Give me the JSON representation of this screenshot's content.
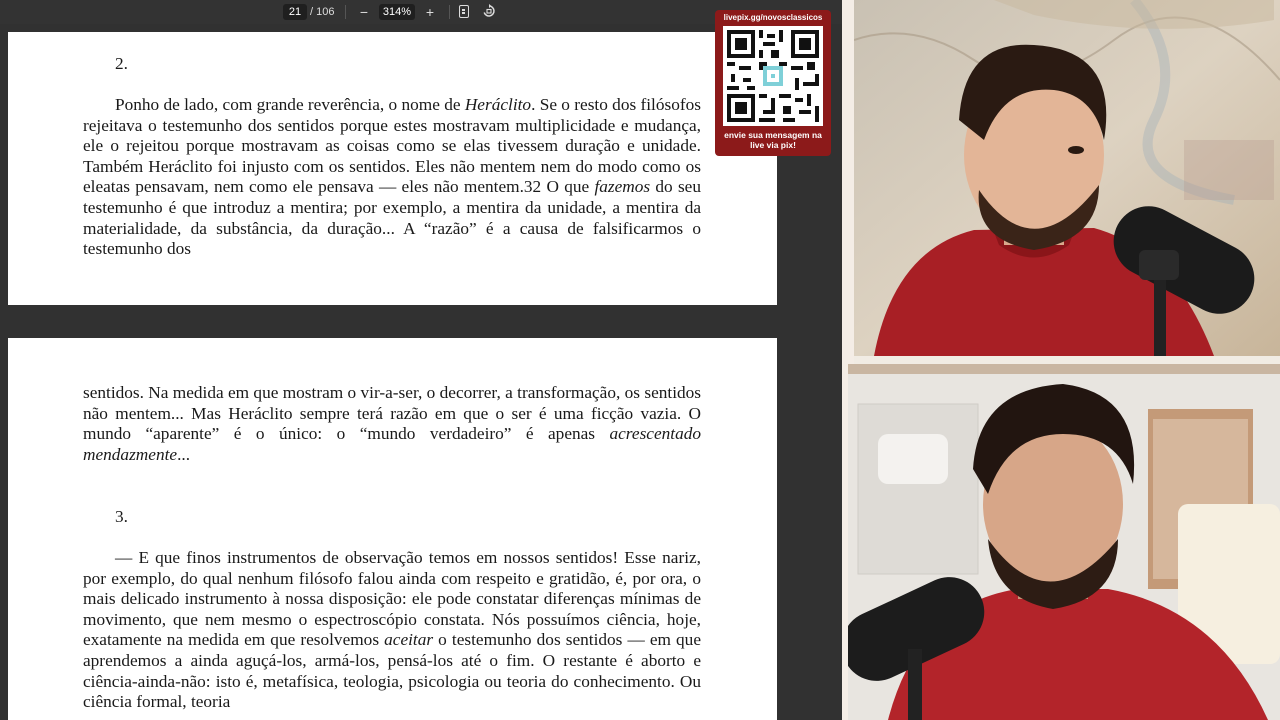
{
  "toolbar": {
    "current_page": "21",
    "total_pages": "/ 106",
    "zoom_out_label": "−",
    "zoom_level": "314%",
    "zoom_in_label": "+",
    "fit_icon": "fit-page-icon",
    "rotate_icon": "rotate-icon"
  },
  "page1": {
    "section_number": "2.",
    "paragraph_html": "Ponho de lado, com grande reverência, o nome de <i>Heráclito</i>. Se o resto dos filósofos rejeitava o testemunho dos sentidos porque estes mostravam multiplicidade e mudança, ele o rejeitou porque mostravam as coisas como se elas tivessem duração e unidade. Também Heráclito foi injusto com os sentidos. Eles não mentem nem do modo como os eleatas pensavam, nem como ele pensava — eles não mentem.32 O que <i>fazemos</i> do seu testemunho é que introduz a mentira; por exemplo, a mentira da unidade, a mentira da materialidade, da substância, da duração... A “razão” é a causa de falsificarmos o testemunho dos"
  },
  "page2": {
    "continuation_html": "sentidos. Na medida em que mostram o vir-a-ser, o decorrer, a transformação, os sentidos não mentem... Mas Heráclito sempre terá razão em que o ser é uma ficção vazia. O mundo “aparente” é o único: o “mundo verdadeiro” é apenas <i>acrescentado mendazmente</i>...",
    "section_number": "3.",
    "paragraph_html": "— E que finos instrumentos de observação temos em nossos sentidos! Esse nariz, por exemplo, do qual nenhum filósofo falou ainda com respeito e gratidão, é, por ora, o mais delicado instrumento à nossa disposição: ele pode constatar diferenças mínimas de movimento, que nem mesmo o espectroscópio constata. Nós possuímos ciência, hoje, exatamente na medida em que resolvemos <i>aceitar</i> o testemunho dos sentidos — em que aprendemos a ainda aguçá-los, armá-los, pensá-los até o fim. O restante é aborto e ciência-ainda-não: isto é, metafísica, teologia, psicologia ou teoria do conhecimento. Ou ciência formal, teoria"
  },
  "qr_overlay": {
    "header": "livepix.gg/novosclassicos",
    "footer": "envie sua mensagem na live via pix!"
  },
  "colors": {
    "qr_background": "#8c1a1a",
    "viewer_background": "#313131",
    "shirt_red": "#b3242a"
  }
}
